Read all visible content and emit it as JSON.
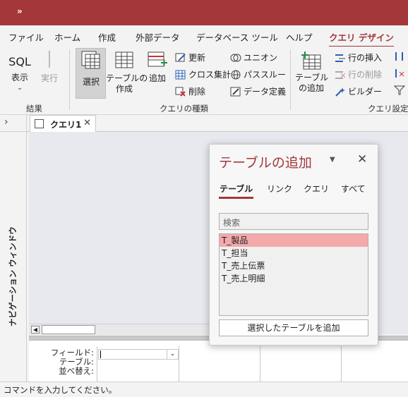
{
  "titlebar": {
    "quick_access": "»"
  },
  "tabs": [
    "ファイル",
    "ホーム",
    "作成",
    "外部データ",
    "データベース ツール",
    "ヘルプ",
    "クエリ デザイン"
  ],
  "active_tab": "クエリ デザイン",
  "ribbon": {
    "results_group": {
      "label": "結果",
      "view_label": "表示",
      "view_icon_text": "SQL",
      "run_label": "実行"
    },
    "query_type_group": {
      "label": "クエリの種類",
      "select": "選択",
      "make_table": [
        "テーブルの",
        "作成"
      ],
      "append": "追加",
      "update": "更新",
      "crosstab": "クロス集計",
      "delete": "削除",
      "union": "ユニオン",
      "passthrough": "パススルー",
      "data_definition": "データ定義"
    },
    "setup_group": {
      "label": "クエリ設定",
      "add_table": [
        "テーブル",
        "の追加"
      ],
      "insert_rows": "行の挿入",
      "delete_rows": "行の削除",
      "builder": "ビルダー"
    }
  },
  "nav_pane": {
    "label": "ナビゲーション ウィンドウ",
    "toggle": "›"
  },
  "doc_tab": {
    "title": "クエリ1",
    "close": "✕"
  },
  "grid": {
    "rows": [
      "フィールド:",
      "テーブル:",
      "並べ替え:"
    ]
  },
  "status": "コマンドを入力してください。",
  "dialog": {
    "title": "テーブルの追加",
    "close": "✕",
    "tabs": [
      "テーブル",
      "リンク",
      "クエリ",
      "すべて"
    ],
    "active_tab": "テーブル",
    "search_placeholder": "検索",
    "tables": [
      "T_製品",
      "T_担当",
      "T_売上伝票",
      "T_売上明細"
    ],
    "selected_table": "T_製品",
    "add_button": "選択したテーブルを追加"
  },
  "colors": {
    "accent": "#a4373a",
    "selection": "#f4a9ab"
  }
}
